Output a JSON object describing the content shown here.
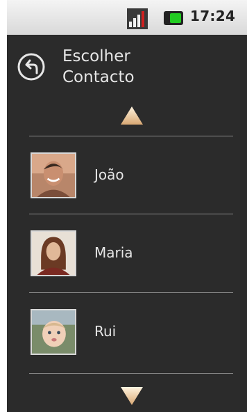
{
  "status": {
    "time": "17:24"
  },
  "header": {
    "back_icon": "back-arrow-icon",
    "title_line1": "Escolher",
    "title_line2": "Contacto"
  },
  "contacts": [
    {
      "name": "João"
    },
    {
      "name": "Maria"
    },
    {
      "name": "Rui"
    }
  ],
  "colors": {
    "background": "#2b2b2b",
    "battery": "#22cc22",
    "arrow": "#e8c79a"
  }
}
